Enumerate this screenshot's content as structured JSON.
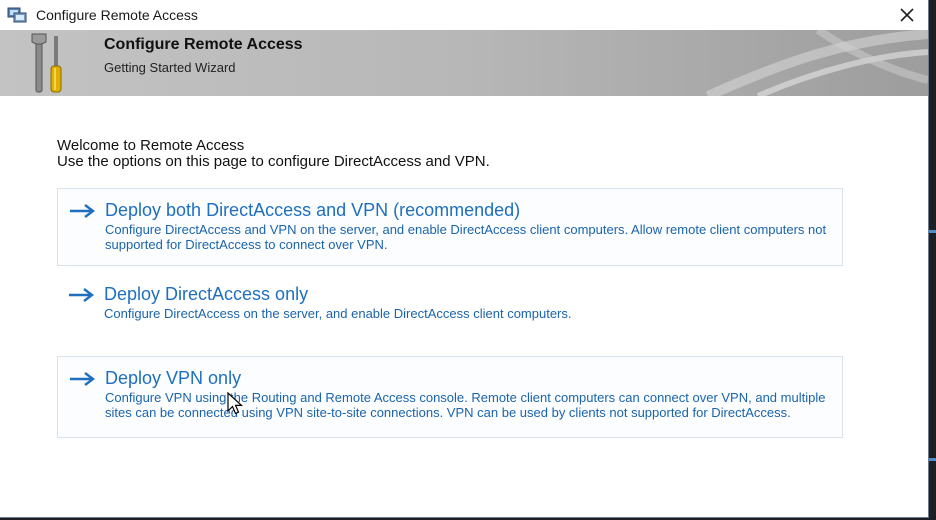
{
  "window": {
    "title": "Configure Remote Access",
    "close_icon": "close-icon"
  },
  "banner": {
    "title": "Configure Remote Access",
    "subtitle": "Getting Started Wizard"
  },
  "intro": {
    "line1": "Welcome to Remote Access",
    "line2": "Use the options on this page to configure DirectAccess and VPN."
  },
  "options": [
    {
      "title": "Deploy both DirectAccess and VPN (recommended)",
      "description": "Configure DirectAccess and VPN on the server, and enable DirectAccess client computers. Allow remote client computers not supported for DirectAccess to connect over VPN."
    },
    {
      "title": "Deploy DirectAccess only",
      "description": "Configure DirectAccess on the server, and enable DirectAccess client computers."
    },
    {
      "title": "Deploy VPN only",
      "description": "Configure VPN using the Routing and Remote Access console. Remote client computers can connect over VPN, and multiple sites can be connected using VPN site-to-site connections. VPN can be used by clients not supported for DirectAccess."
    }
  ],
  "colors": {
    "link": "#1f6fbf",
    "banner": "#b7b7b7",
    "option_border": "#d8e2ec"
  }
}
